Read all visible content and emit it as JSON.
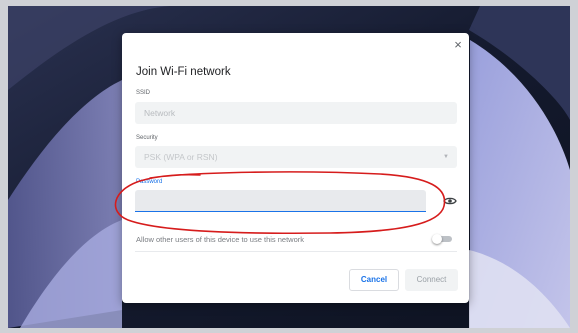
{
  "dialog": {
    "title": "Join Wi-Fi network",
    "close_glyph": "×",
    "ssid": {
      "label": "SSID",
      "placeholder": "Network"
    },
    "security": {
      "label": "Security",
      "value": "PSK (WPA or RSN)",
      "caret": "▼"
    },
    "password": {
      "label": "Password",
      "value": ""
    },
    "share": {
      "label": "Allow other users of this device to use this network",
      "enabled": false
    },
    "buttons": {
      "cancel": "Cancel",
      "connect": "Connect"
    }
  },
  "icons": {
    "close": "close-icon",
    "eye": "eye-icon",
    "caret": "dropdown-arrow-icon"
  },
  "colors": {
    "accent": "#1a73e8",
    "annotation": "#d61c1c",
    "field_bg": "#f1f3f4"
  }
}
